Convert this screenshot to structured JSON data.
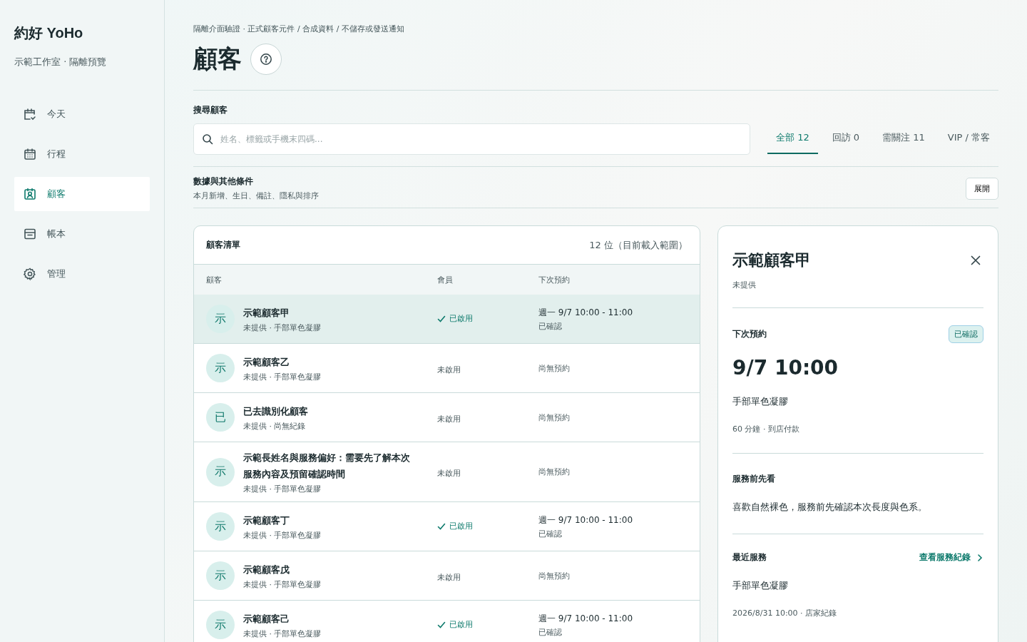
{
  "sidebar": {
    "brand": "約好 YoHo",
    "subtitle": "示範工作室 · 隔離預覽",
    "items": [
      {
        "label": "今天",
        "kind": "today",
        "selected": false
      },
      {
        "label": "行程",
        "kind": "schedule",
        "selected": false
      },
      {
        "label": "顧客",
        "kind": "customers",
        "selected": true
      },
      {
        "label": "帳本",
        "kind": "ledger",
        "selected": false
      },
      {
        "label": "管理",
        "kind": "settings",
        "selected": false
      }
    ]
  },
  "breadcrumb": "隔離介面驗證 · 正式顧客元件 / 合成資料 / 不儲存或發送通知",
  "page_title": "顧客",
  "search": {
    "label": "搜尋顧客",
    "placeholder": "姓名、標籤或手機末四碼..."
  },
  "tabs": [
    {
      "label": "全部 12",
      "selected": true
    },
    {
      "label": "回訪 0",
      "selected": false
    },
    {
      "label": "需關注 11",
      "selected": false
    },
    {
      "label": "VIP / 常客",
      "selected": false
    }
  ],
  "filters": {
    "title": "數據與其他條件",
    "subtitle": "本月新增、生日、備註、隱私與排序",
    "button": "展開"
  },
  "list": {
    "title": "顧客清單",
    "count": "12 位（目前載入範圍）",
    "columns": [
      "顧客",
      "會員",
      "下次預約"
    ],
    "rows": [
      {
        "avatar": "示",
        "name": "示範顧客甲",
        "meta": "未提供 · 手部單色凝膠",
        "member": "已啟用",
        "member_active": true,
        "next": "週一 9/7 10:00 - 11:00",
        "next_status": "已確認",
        "selected": true
      },
      {
        "avatar": "示",
        "name": "示範顧客乙",
        "meta": "未提供 · 手部單色凝膠",
        "member": "未啟用",
        "member_active": false,
        "next": "尚無預約",
        "selected": false
      },
      {
        "avatar": "已",
        "name": "已去識別化顧客",
        "meta": "未提供 · 尚無紀錄",
        "member": "未啟用",
        "member_active": false,
        "next": "尚無預約",
        "selected": false
      },
      {
        "avatar": "示",
        "name": "示範長姓名與服務偏好：需要先了解本次服務內容及預留確認時間",
        "meta": "未提供 · 手部單色凝膠",
        "member": "未啟用",
        "member_active": false,
        "next": "尚無預約",
        "selected": false
      },
      {
        "avatar": "示",
        "name": "示範顧客丁",
        "meta": "未提供 · 手部單色凝膠",
        "member": "已啟用",
        "member_active": true,
        "next": "週一 9/7 10:00 - 11:00",
        "next_status": "已確認",
        "selected": false
      },
      {
        "avatar": "示",
        "name": "示範顧客戊",
        "meta": "未提供 · 手部單色凝膠",
        "member": "未啟用",
        "member_active": false,
        "next": "尚無預約",
        "selected": false
      },
      {
        "avatar": "示",
        "name": "示範顧客己",
        "meta": "未提供 · 手部單色凝膠",
        "member": "已啟用",
        "member_active": true,
        "next": "週一 9/7 10:00 - 11:00",
        "next_status": "已確認",
        "selected": false
      }
    ]
  },
  "detail": {
    "name": "示範顧客甲",
    "phone": "未提供",
    "next_label": "下次預約",
    "status_badge": "已確認",
    "time": "9/7 10:00",
    "service": "手部單色凝膠",
    "info": "60 分鐘 · 到店付款",
    "notes_label": "服務前先看",
    "notes": "喜歡自然裸色，服務前先確認本次長度與色系。",
    "recent_label": "最近服務",
    "recent_link": "查看服務紀錄",
    "recent_service": "手部單色凝膠",
    "recent_meta": "2026/8/31 10:00 · 店家紀錄"
  }
}
